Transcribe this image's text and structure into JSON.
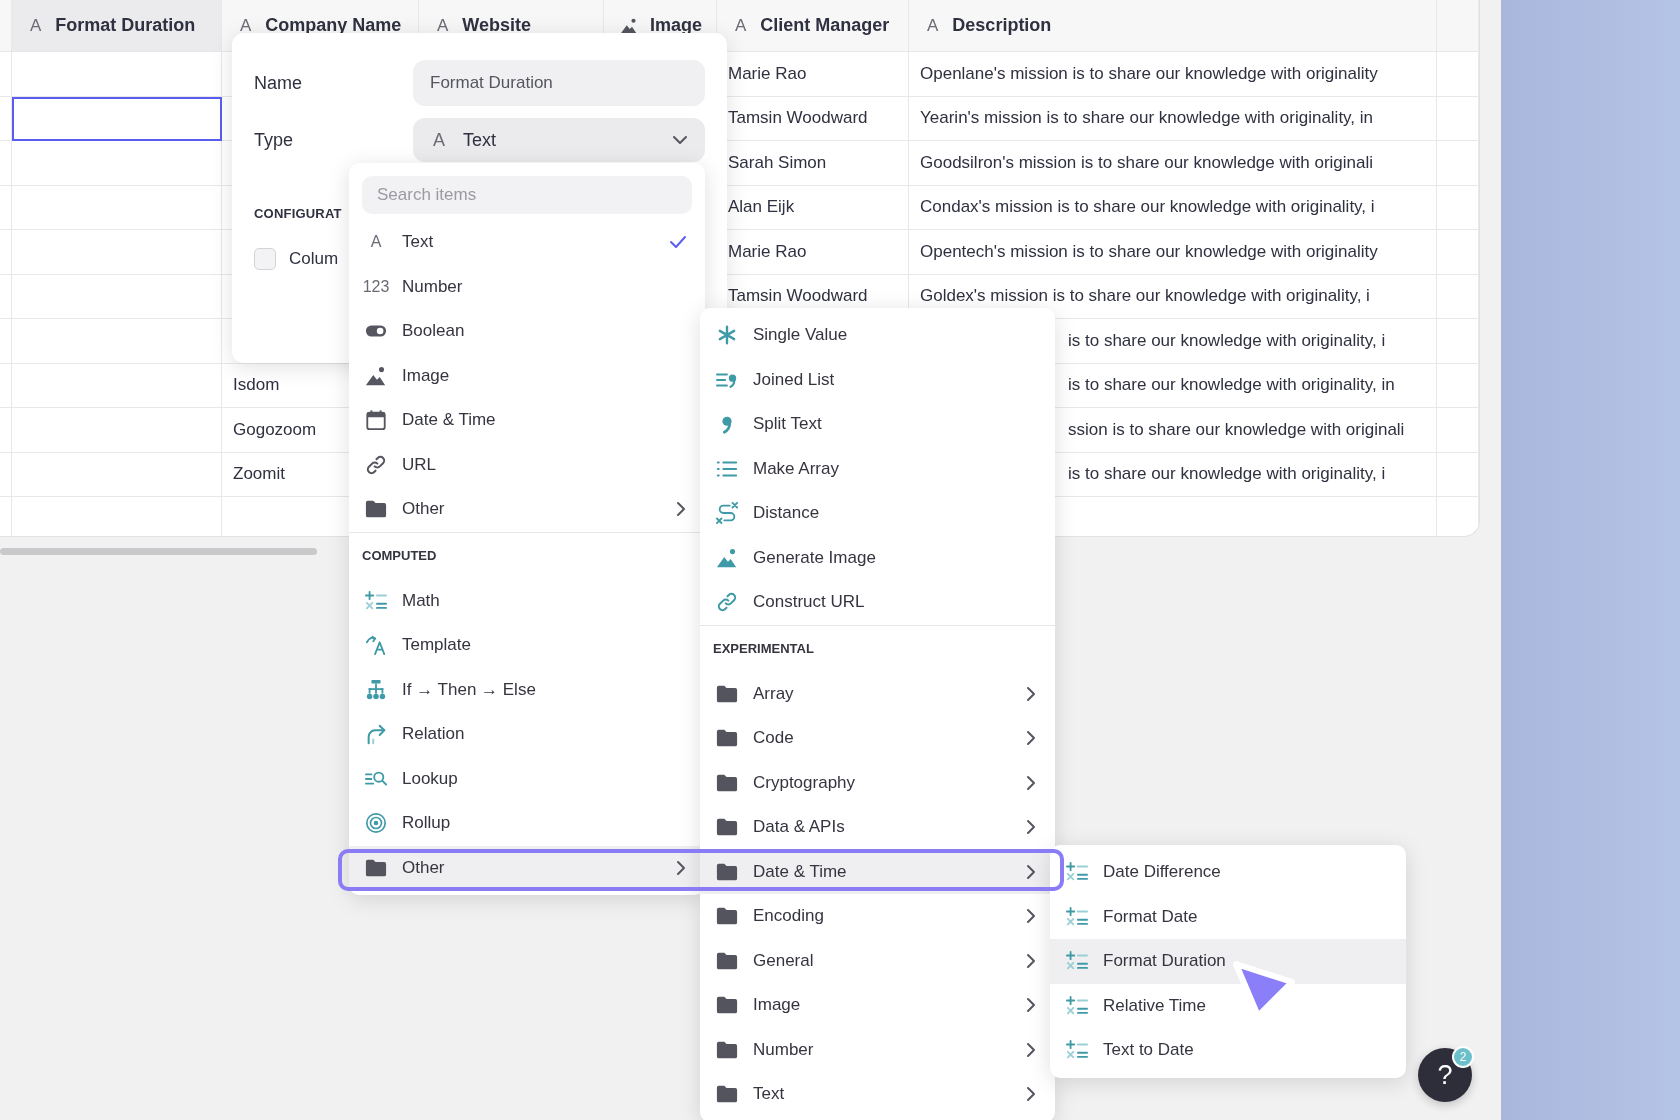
{
  "table": {
    "columns": [
      {
        "title": "Format Duration",
        "glyph": "A",
        "selected": true
      },
      {
        "title": "Company Name",
        "glyph": "A",
        "selected": false
      },
      {
        "title": "Website",
        "glyph": "A",
        "selected": false
      },
      {
        "title": "Image",
        "selected": false
      },
      {
        "title": "Client Manager",
        "glyph": "A",
        "selected": false
      },
      {
        "title": "Description",
        "glyph": "A",
        "selected": false
      }
    ],
    "rows": [
      {
        "selected": false,
        "client_manager": "Marie Rao",
        "description": "Openlane's mission is to share our knowledge with originality"
      },
      {
        "selected": true,
        "client_manager": "Tamsin Woodward",
        "description": "Yearin's mission is to share our knowledge with originality, in"
      },
      {
        "selected": false,
        "client_manager": "Sarah Simon",
        "description": "Goodsilron's mission is to share our knowledge with originali"
      },
      {
        "selected": false,
        "client_manager": "Alan Eijk",
        "description": "Condax's mission is to share our knowledge with originality, i"
      },
      {
        "selected": false,
        "client_manager": "Marie Rao",
        "description": "Opentech's mission is to share our knowledge with originality"
      },
      {
        "selected": false,
        "client_manager": "Tamsin Woodward",
        "description": "Goldex's mission is to share our knowledge with originality, i"
      },
      {
        "selected": false,
        "description": "is to share our knowledge with originality, i"
      },
      {
        "selected": false,
        "company_name": "Isdom",
        "description": "is to share our knowledge with originality, in"
      },
      {
        "selected": false,
        "company_name": "Gogozoom",
        "description": "ssion is to share our knowledge with originali"
      },
      {
        "selected": false,
        "company_name": "Zoomit",
        "description": "is to share our knowledge with originality, i"
      }
    ]
  },
  "editor": {
    "name_label": "Name",
    "name_value": "Format Duration",
    "type_label": "Type",
    "type_glyph": "A",
    "type_value": "Text",
    "section": "CONFIGURAT",
    "checkbox": {
      "label": "Colum",
      "checked": false
    }
  },
  "menus": [
    {
      "search_placeholder": "Search items",
      "sections": [
        {
          "items": [
            {
              "label": "Text",
              "glyph": "A",
              "checked": true,
              "selected": false,
              "has_submenu": false
            },
            {
              "label": "Number",
              "glyph": "123",
              "checked": false,
              "selected": false,
              "has_submenu": false
            },
            {
              "label": "Boolean",
              "checked": false,
              "selected": false,
              "has_submenu": false
            },
            {
              "label": "Image",
              "checked": false,
              "selected": false,
              "has_submenu": false
            },
            {
              "label": "Date & Time",
              "checked": false,
              "selected": false,
              "has_submenu": false
            },
            {
              "label": "URL",
              "checked": false,
              "selected": false,
              "has_submenu": false
            },
            {
              "label": "Other",
              "checked": false,
              "selected": false,
              "has_submenu": true
            }
          ]
        },
        {
          "heading": "COMPUTED",
          "items": [
            {
              "label": "Math",
              "checked": false,
              "selected": false,
              "has_submenu": false
            },
            {
              "label": "Template",
              "checked": false,
              "selected": false,
              "has_submenu": false
            },
            {
              "label": "If → Then → Else",
              "checked": false,
              "selected": false,
              "has_submenu": false
            },
            {
              "label": "Relation",
              "checked": false,
              "selected": false,
              "has_submenu": false
            },
            {
              "label": "Lookup",
              "checked": false,
              "selected": false,
              "has_submenu": false
            },
            {
              "label": "Rollup",
              "checked": false,
              "selected": false,
              "has_submenu": false
            },
            {
              "label": "Other",
              "checked": false,
              "selected": true,
              "has_submenu": true
            }
          ]
        }
      ]
    },
    {
      "sections": [
        {
          "items": [
            {
              "label": "Single Value",
              "selected": false,
              "has_submenu": false
            },
            {
              "label": "Joined List",
              "selected": false,
              "has_submenu": false
            },
            {
              "label": "Split Text",
              "selected": false,
              "has_submenu": false
            },
            {
              "label": "Make Array",
              "selected": false,
              "has_submenu": false
            },
            {
              "label": "Distance",
              "selected": false,
              "has_submenu": false
            },
            {
              "label": "Generate Image",
              "selected": false,
              "has_submenu": false
            },
            {
              "label": "Construct URL",
              "selected": false,
              "has_submenu": false
            }
          ]
        },
        {
          "heading": "EXPERIMENTAL",
          "items": [
            {
              "label": "Array",
              "selected": false,
              "has_submenu": true
            },
            {
              "label": "Code",
              "selected": false,
              "has_submenu": true
            },
            {
              "label": "Cryptography",
              "selected": false,
              "has_submenu": true
            },
            {
              "label": "Data & APIs",
              "selected": false,
              "has_submenu": true
            },
            {
              "label": "Date & Time",
              "selected": true,
              "has_submenu": true
            },
            {
              "label": "Encoding",
              "selected": false,
              "has_submenu": true
            },
            {
              "label": "General",
              "selected": false,
              "has_submenu": true
            },
            {
              "label": "Image",
              "selected": false,
              "has_submenu": true
            },
            {
              "label": "Number",
              "selected": false,
              "has_submenu": true
            },
            {
              "label": "Text",
              "selected": false,
              "has_submenu": true
            }
          ]
        }
      ]
    },
    {
      "sections": [
        {
          "items": [
            {
              "label": "Date Difference",
              "selected": false,
              "has_submenu": false
            },
            {
              "label": "Format Date",
              "selected": false,
              "has_submenu": false
            },
            {
              "label": "Format Duration",
              "selected": true,
              "has_submenu": false
            },
            {
              "label": "Relative Time",
              "selected": false,
              "has_submenu": false
            },
            {
              "label": "Text to Date",
              "selected": false,
              "has_submenu": false
            }
          ]
        }
      ]
    }
  ],
  "help": {
    "label": "?",
    "badge": "2"
  }
}
